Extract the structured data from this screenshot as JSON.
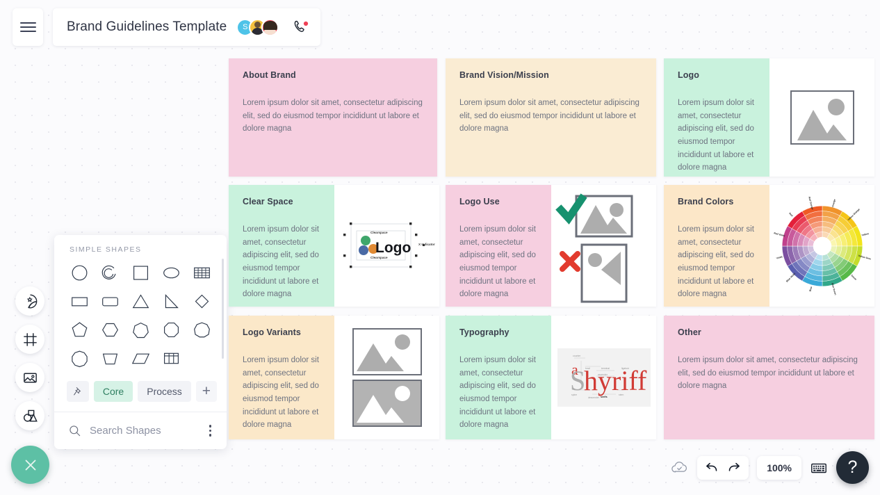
{
  "header": {
    "menu_icon": "hamburger-menu-icon",
    "title": "Brand Guidelines Template",
    "avatars": [
      {
        "name": "avatar-s",
        "initial": "S",
        "color": "#4ec3e8"
      },
      {
        "name": "avatar-user-2",
        "initial": "",
        "color": "#f5c03e"
      },
      {
        "name": "avatar-user-3",
        "initial": "",
        "color": "#ef4155"
      }
    ],
    "call_icon": "phone-call-icon",
    "call_badge_color": "#ef4155"
  },
  "left_rail": {
    "items": [
      {
        "name": "sticker-shapes-tool",
        "icon": "sticker-star-icon"
      },
      {
        "name": "frame-tool",
        "icon": "frame-icon"
      },
      {
        "name": "image-tool",
        "icon": "image-icon"
      },
      {
        "name": "shapes-tool",
        "icon": "shapes-icon"
      }
    ],
    "fab": {
      "name": "close-tools-button",
      "icon": "close-x-icon",
      "color": "#5dc0a5"
    }
  },
  "shapes_panel": {
    "section_label": "SIMPLE SHAPES",
    "shapes": [
      "circle",
      "arc-partial",
      "square",
      "ellipse",
      "table-lines",
      "rectangle-small",
      "rounded-rectangle",
      "triangle",
      "right-triangle",
      "diamond",
      "pentagon",
      "hexagon",
      "heptagon",
      "octagon",
      "nonagon",
      "decagon",
      "trapezoid",
      "parallelogram",
      "table-grid"
    ],
    "tabs": [
      {
        "label": "",
        "name": "pin-tab",
        "icon": "pin-icon",
        "active": false
      },
      {
        "label": "Core",
        "name": "core-tab",
        "active": true
      },
      {
        "label": "Process",
        "name": "process-tab",
        "active": false
      },
      {
        "label": "+",
        "name": "add-library-tab",
        "active": false
      }
    ],
    "search": {
      "placeholder": "Search Shapes",
      "value": "",
      "icon": "search-icon",
      "menu_icon": "kebab-menu-icon"
    }
  },
  "body_text": "Lorem ipsum dolor sit amet, consectetur adipiscing elit, sed do eiusmod tempor incididunt ut labore et dolore magna",
  "cards": [
    {
      "id": "about-brand",
      "title": "About Brand",
      "body": "Lorem ipsum dolor sit amet, consectetur adipiscing elit, sed do eiusmod tempor incididunt ut labore et dolore magna",
      "color": "#f6cfe0",
      "visual": "none"
    },
    {
      "id": "brand-vision-mission",
      "title": "Brand Vision/Mission",
      "body": "Lorem ipsum dolor sit amet, consectetur adipiscing elit, sed do eiusmod tempor incididunt ut labore et dolore magna",
      "color": "#faecd3",
      "visual": "none"
    },
    {
      "id": "logo",
      "title": "Logo",
      "body": "Lorem ipsum dolor sit amet, consectetur adipiscing elit, sed do eiusmod tempor incididunt ut labore et dolore magna",
      "color": "#c9f2dd",
      "visual": "image-placeholder"
    },
    {
      "id": "clear-space",
      "title": "Clear Space",
      "body": "Lorem ipsum dolor sit amet, consectetur adipiscing elit, sed do eiusmod tempor incididunt ut labore et dolore magna",
      "color": "#c9f2dd",
      "visual": "clearspace-diagram"
    },
    {
      "id": "logo-use",
      "title": "Logo Use",
      "body": "Lorem ipsum dolor sit amet, consectetur adipiscing elit, sed do eiusmod tempor incididunt ut labore et dolore magna",
      "color": "#f6cfe0",
      "visual": "logo-use-check-cross"
    },
    {
      "id": "brand-colors",
      "title": "Brand Colors",
      "body": "Lorem ipsum dolor sit amet, consectetur adipiscing elit, sed do eiusmod tempor incididunt ut labore et dolore magna",
      "color": "#fce7c8",
      "visual": "color-wheel"
    },
    {
      "id": "logo-variants",
      "title": "Logo Variants",
      "body": "Lorem ipsum dolor sit amet, consectetur adipiscing elit, sed do eiusmod tempor incididunt ut labore et dolore magna",
      "color": "#fbe8c9",
      "visual": "two-image-placeholders"
    },
    {
      "id": "typography",
      "title": "Typography",
      "body": "Lorem ipsum dolor sit amet, consectetur adipiscing elit, sed do eiusmod tempor incididunt ut labore et dolore magna",
      "color": "#c9f2dd",
      "visual": "typography-anatomy"
    },
    {
      "id": "other",
      "title": "Other",
      "body": "Lorem ipsum dolor sit amet, consectetur adipiscing elit, sed do eiusmod tempor incididunt ut labore et dolore magna",
      "color": "#f6cfe0",
      "visual": "none"
    }
  ],
  "clearspace_diagram": {
    "logo_text": "Logo",
    "label_top": "Clearspace",
    "label_bottom": "Clearspace",
    "label_right": "X Indicator",
    "dot_colors": [
      "#3fa66b",
      "#4a6aa5",
      "#e08a34"
    ]
  },
  "color_wheel": {
    "labels": [
      "Orange",
      "Yellow Orange",
      "Yellow",
      "Yellow Green",
      "Green",
      "Blue Green",
      "Blue",
      "Blue Violet",
      "Violet",
      "Red Violet",
      "Red",
      "Red Orange"
    ],
    "hues": [
      "#f0932b",
      "#f5c518",
      "#f2e41c",
      "#c5dd2b",
      "#57b947",
      "#31a88a",
      "#3aa9d8",
      "#5a5fb0",
      "#7b4fa0",
      "#c0418c",
      "#e4203a",
      "#ef5a24"
    ]
  },
  "typography_diagram": {
    "word": "Shyriff",
    "labels": [
      "counter",
      "bowl",
      "terminal",
      "ligature",
      "ascender",
      "spine",
      "descender",
      "serifs",
      "stem"
    ]
  },
  "bottom_toolbar": {
    "save_icon": "cloud-saved-icon",
    "undo_icon": "undo-icon",
    "redo_icon": "redo-icon",
    "zoom_level": "100%",
    "keyboard_icon": "keyboard-icon",
    "help_label": "?"
  }
}
